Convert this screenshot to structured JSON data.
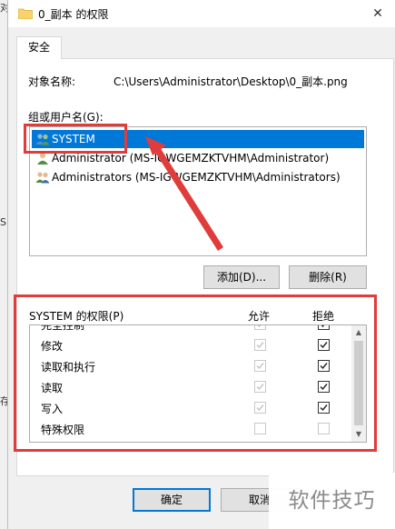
{
  "background_window": {
    "glyphs": [
      "对",
      "S",
      "存"
    ]
  },
  "window": {
    "title": "0_副本 的权限",
    "close_glyph": "✕"
  },
  "tab": {
    "label": "安全"
  },
  "object": {
    "label": "对象名称:",
    "path": "C:\\Users\\Administrator\\Desktop\\0_副本.png"
  },
  "groups": {
    "label": "组或用户名(G):",
    "items": [
      {
        "name": "SYSTEM",
        "selected": true,
        "icon": "group-users-icon"
      },
      {
        "name": "Administrator (MS-IGWGEMZKTVHM\\Administrator)",
        "selected": false,
        "icon": "user-icon"
      },
      {
        "name": "Administrators (MS-IGWGEMZKTVHM\\Administrators)",
        "selected": false,
        "icon": "group-users-icon"
      }
    ]
  },
  "buttons": {
    "add": "添加(D)...",
    "remove": "删除(R)",
    "ok": "确定",
    "cancel": "取消"
  },
  "permissions": {
    "label": "SYSTEM 的权限(P)",
    "allow_header": "允许",
    "deny_header": "拒绝",
    "rows": [
      {
        "name": "完全控制",
        "allow": true,
        "allow_disabled": true,
        "deny": true
      },
      {
        "name": "修改",
        "allow": true,
        "allow_disabled": true,
        "deny": true
      },
      {
        "name": "读取和执行",
        "allow": true,
        "allow_disabled": true,
        "deny": true
      },
      {
        "name": "读取",
        "allow": true,
        "allow_disabled": true,
        "deny": true
      },
      {
        "name": "写入",
        "allow": true,
        "allow_disabled": true,
        "deny": true
      },
      {
        "name": "特殊权限",
        "allow": false,
        "allow_disabled": true,
        "deny": false,
        "deny_disabled": true
      }
    ]
  },
  "watermark": "软件技巧",
  "colors": {
    "selection": "#0078d7",
    "highlight": "#e03c3c"
  }
}
